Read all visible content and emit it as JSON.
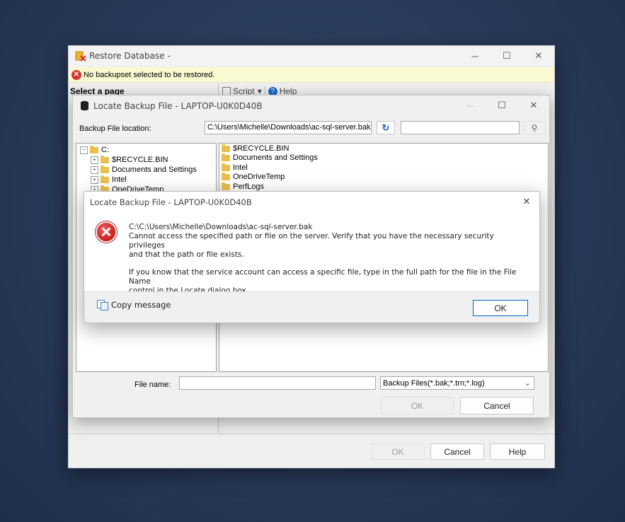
{
  "restore_window": {
    "title": "Restore Database -",
    "warning": "No backupset selected to be restored.",
    "select_page_header": "Select a page",
    "toolbar_script": "Script",
    "toolbar_help": "Help",
    "buttons": {
      "ok": "OK",
      "cancel": "Cancel",
      "help": "Help"
    }
  },
  "locate_dialog": {
    "title": "Locate Backup File - LAPTOP-U0K0D40B",
    "backup_location_label": "Backup File location:",
    "backup_location_value": "C:\\Users\\Michelle\\Downloads\\ac-sql-server.bak",
    "search_value": "",
    "tree": [
      {
        "label": "C:",
        "expanded": true
      },
      {
        "label": "$RECYCLE.BIN"
      },
      {
        "label": "Documents and Settings"
      },
      {
        "label": "Intel"
      },
      {
        "label": "OneDriveTemp"
      }
    ],
    "file_list": [
      "$RECYCLE.BIN",
      "Documents and Settings",
      "Intel",
      "OneDriveTemp",
      "PerfLogs"
    ],
    "file_name_label": "File name:",
    "file_name_value": "",
    "file_type_selected": "Backup Files(*.bak;*.trn;*.log)",
    "buttons": {
      "ok": "OK",
      "cancel": "Cancel"
    }
  },
  "error_box": {
    "title": "Locate Backup File - LAPTOP-U0K0D40B",
    "line1": "C:\\C:\\Users\\Michelle\\Downloads\\ac-sql-server.bak",
    "line2": "Cannot access the specified path or file on the server. Verify that you have the necessary security privileges",
    "line3": "and that the path or file exists.",
    "line4": "If you know that the service account can access a specific file, type in the full path for the file in the File Name",
    "line5": "control in the Locate dialog box.",
    "copy_message": "Copy message",
    "ok": "OK"
  },
  "icons": {
    "close": "✕",
    "minimize": "─",
    "maximize": "☐",
    "refresh": "↻",
    "search": "⚲",
    "error": "✕",
    "dropdown": "⌄"
  }
}
